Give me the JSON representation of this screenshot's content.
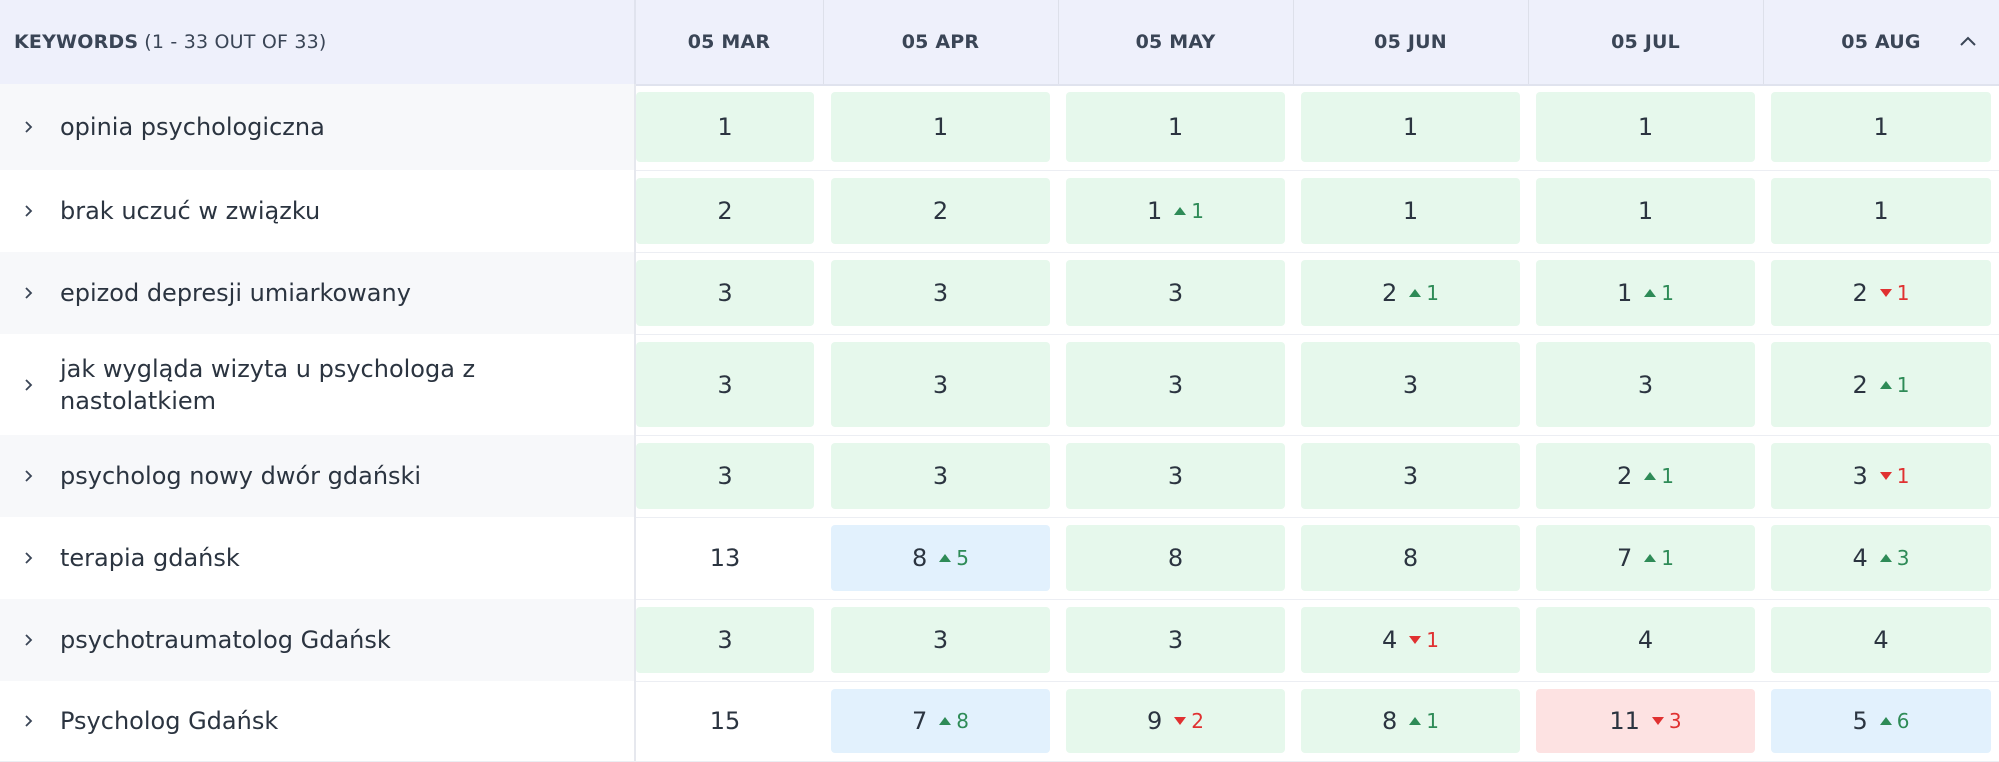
{
  "header": {
    "keywords_label": "KEYWORDS",
    "keywords_count": "(1 - 33 OUT OF 33)",
    "columns": [
      "05 MAR",
      "05 APR",
      "05 MAY",
      "05 JUN",
      "05 JUL",
      "05 AUG"
    ],
    "collapse_icon": "chevron-up-icon"
  },
  "colors": {
    "improved": "#e6f8ec",
    "big_improvement": "#e2f1fd",
    "dropped": "#fde2e2",
    "up": "#2e8b57",
    "down": "#e03131"
  },
  "rows": [
    {
      "keyword": "opinia psychologiczna",
      "cells": [
        {
          "v": "1",
          "bg": "green"
        },
        {
          "v": "1",
          "bg": "green"
        },
        {
          "v": "1",
          "bg": "green"
        },
        {
          "v": "1",
          "bg": "green"
        },
        {
          "v": "1",
          "bg": "green"
        },
        {
          "v": "1",
          "bg": "green"
        }
      ]
    },
    {
      "keyword": "brak uczuć w związku",
      "cells": [
        {
          "v": "2",
          "bg": "green"
        },
        {
          "v": "2",
          "bg": "green"
        },
        {
          "v": "1",
          "bg": "green",
          "dir": "up",
          "d": "1"
        },
        {
          "v": "1",
          "bg": "green"
        },
        {
          "v": "1",
          "bg": "green"
        },
        {
          "v": "1",
          "bg": "green"
        }
      ]
    },
    {
      "keyword": "epizod depresji umiarkowany",
      "cells": [
        {
          "v": "3",
          "bg": "green"
        },
        {
          "v": "3",
          "bg": "green"
        },
        {
          "v": "3",
          "bg": "green"
        },
        {
          "v": "2",
          "bg": "green",
          "dir": "up",
          "d": "1"
        },
        {
          "v": "1",
          "bg": "green",
          "dir": "up",
          "d": "1"
        },
        {
          "v": "2",
          "bg": "green",
          "dir": "down",
          "d": "1"
        }
      ]
    },
    {
      "keyword": "jak wygląda wizyta u psychologa z nastolatkiem",
      "cells": [
        {
          "v": "3",
          "bg": "green"
        },
        {
          "v": "3",
          "bg": "green"
        },
        {
          "v": "3",
          "bg": "green"
        },
        {
          "v": "3",
          "bg": "green"
        },
        {
          "v": "3",
          "bg": "green"
        },
        {
          "v": "2",
          "bg": "green",
          "dir": "up",
          "d": "1"
        }
      ]
    },
    {
      "keyword": "psycholog nowy dwór gdański",
      "cells": [
        {
          "v": "3",
          "bg": "green"
        },
        {
          "v": "3",
          "bg": "green"
        },
        {
          "v": "3",
          "bg": "green"
        },
        {
          "v": "3",
          "bg": "green"
        },
        {
          "v": "2",
          "bg": "green",
          "dir": "up",
          "d": "1"
        },
        {
          "v": "3",
          "bg": "green",
          "dir": "down",
          "d": "1"
        }
      ]
    },
    {
      "keyword": "terapia gdańsk",
      "cells": [
        {
          "v": "13",
          "bg": "none"
        },
        {
          "v": "8",
          "bg": "blue",
          "dir": "up",
          "d": "5"
        },
        {
          "v": "8",
          "bg": "green"
        },
        {
          "v": "8",
          "bg": "green"
        },
        {
          "v": "7",
          "bg": "green",
          "dir": "up",
          "d": "1"
        },
        {
          "v": "4",
          "bg": "green",
          "dir": "up",
          "d": "3"
        }
      ]
    },
    {
      "keyword": "psychotraumatolog Gdańsk",
      "cells": [
        {
          "v": "3",
          "bg": "green"
        },
        {
          "v": "3",
          "bg": "green"
        },
        {
          "v": "3",
          "bg": "green"
        },
        {
          "v": "4",
          "bg": "green",
          "dir": "down",
          "d": "1"
        },
        {
          "v": "4",
          "bg": "green"
        },
        {
          "v": "4",
          "bg": "green"
        }
      ]
    },
    {
      "keyword": "Psycholog Gdańsk",
      "cells": [
        {
          "v": "15",
          "bg": "none"
        },
        {
          "v": "7",
          "bg": "blue",
          "dir": "up",
          "d": "8"
        },
        {
          "v": "9",
          "bg": "green",
          "dir": "down",
          "d": "2"
        },
        {
          "v": "8",
          "bg": "green",
          "dir": "up",
          "d": "1"
        },
        {
          "v": "11",
          "bg": "red",
          "dir": "down",
          "d": "3"
        },
        {
          "v": "5",
          "bg": "blue",
          "dir": "up",
          "d": "6"
        }
      ]
    }
  ]
}
